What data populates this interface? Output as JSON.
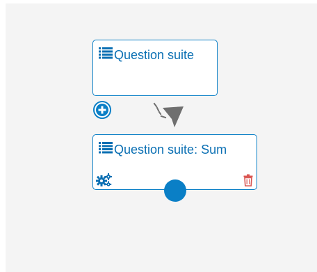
{
  "nodes": [
    {
      "title": "Question suite",
      "icon": "list-icon"
    },
    {
      "title": "Question suite: Sum",
      "icon": "list-icon",
      "actions": [
        "gears-icon",
        "trash-icon"
      ]
    }
  ],
  "controls": {
    "add_icon": "plus-circle-icon",
    "connector_icon": "arrow-down-right-icon"
  },
  "colors": {
    "accent": "#0a7fc6",
    "title_text": "#0a6fb3",
    "delete": "#d9534f",
    "arrow": "#6f6f6f",
    "canvas_bg": "#f4f4f4"
  }
}
